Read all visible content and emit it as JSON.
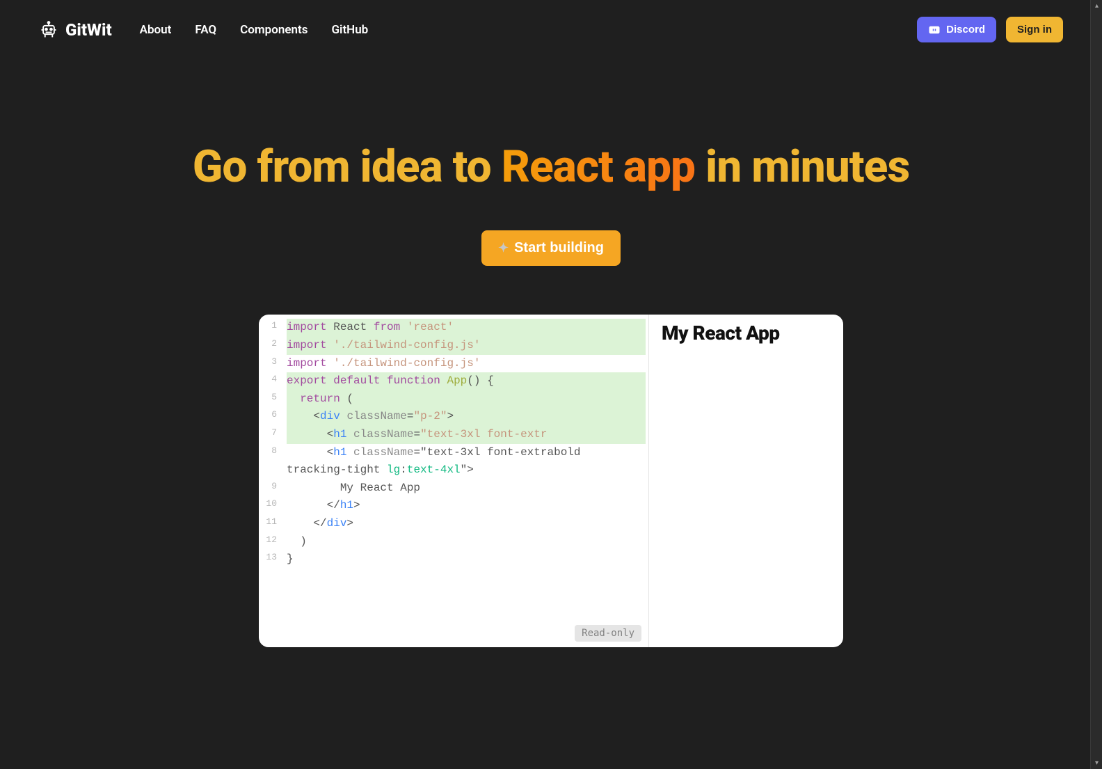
{
  "brand": {
    "name": "GitWit"
  },
  "nav": {
    "about": "About",
    "faq": "FAQ",
    "components": "Components",
    "github": "GitHub"
  },
  "header": {
    "discord": "Discord",
    "signin": "Sign in"
  },
  "hero": {
    "pre": "Go from idea to ",
    "accent": "React app",
    "post": " in minutes"
  },
  "cta": {
    "start": "Start building"
  },
  "editor": {
    "readonly": "Read-only",
    "lines": [
      1,
      2,
      3,
      4,
      5,
      6,
      7,
      8,
      9,
      10,
      11,
      12,
      13
    ],
    "raw": "import React from 'react'\nimport './tailwind-config.js'\nimport './tailwind-config.js'\nexport default function App() {\n  return (\n    <div className=\"p-2\">\n      <h1 className=\"text-3xl font-extr\n      <h1 className=\"text-3xl font-extrabold tracking-tight lg:text-4xl\">\n        My React App\n      </h1>\n    </div>\n  )\n}"
  },
  "preview": {
    "title": "My React App"
  },
  "colors": {
    "accent": "#f5a623",
    "discord": "#6366f1",
    "bg": "#1f1f1f"
  }
}
